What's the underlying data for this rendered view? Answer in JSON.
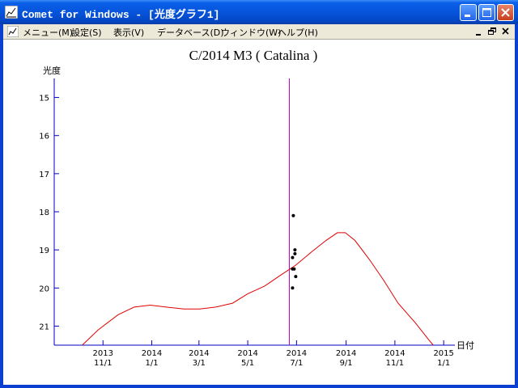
{
  "window": {
    "title": "Comet for Windows - [光度グラフ1]",
    "colors": {
      "titlebar": "#0654db",
      "close_button": "#c5401e",
      "menubar": "#ece9d8"
    }
  },
  "menu": {
    "items": [
      {
        "id": "menu",
        "label": "メニュー(M)"
      },
      {
        "id": "settings",
        "label": "設定(S)"
      },
      {
        "id": "view",
        "label": "表示(V)"
      },
      {
        "id": "database",
        "label": "データベース(D)"
      },
      {
        "id": "window",
        "label": "ウィンドウ(W)"
      },
      {
        "id": "help",
        "label": "ヘルプ(H)"
      }
    ]
  },
  "icons": {
    "app": "graph-icon",
    "minimize": "minimize-icon",
    "maximize": "maximize-icon",
    "close": "close-icon",
    "restore": "restore-icon"
  },
  "chart_data": {
    "type": "line",
    "title": "C/2014 M3 ( Catalina )",
    "ylabel": "光度",
    "xlabel": "日付",
    "y_inverted": true,
    "ylim": [
      21.5,
      14.5
    ],
    "xlim": [
      "2013-09-01",
      "2015-01-15"
    ],
    "y_ticks": [
      15,
      16,
      17,
      18,
      19,
      20,
      21
    ],
    "x_ticks": [
      {
        "date": "2013-11-01",
        "label_top": "2013",
        "label_bottom": "11/1"
      },
      {
        "date": "2014-01-01",
        "label_top": "2014",
        "label_bottom": "1/1"
      },
      {
        "date": "2014-03-01",
        "label_top": "2014",
        "label_bottom": "3/1"
      },
      {
        "date": "2014-05-01",
        "label_top": "2014",
        "label_bottom": "5/1"
      },
      {
        "date": "2014-07-01",
        "label_top": "2014",
        "label_bottom": "7/1"
      },
      {
        "date": "2014-09-01",
        "label_top": "2014",
        "label_bottom": "9/1"
      },
      {
        "date": "2014-11-01",
        "label_top": "2014",
        "label_bottom": "11/1"
      },
      {
        "date": "2015-01-01",
        "label_top": "2015",
        "label_bottom": "1/1"
      }
    ],
    "curve": {
      "color": "#e00000",
      "points": [
        [
          "2013-10-06",
          21.5
        ],
        [
          "2013-10-26",
          21.1
        ],
        [
          "2013-11-20",
          20.7
        ],
        [
          "2013-12-10",
          20.5
        ],
        [
          "2013-12-30",
          20.45
        ],
        [
          "2014-01-19",
          20.5
        ],
        [
          "2014-02-10",
          20.55
        ],
        [
          "2014-03-02",
          20.55
        ],
        [
          "2014-03-22",
          20.5
        ],
        [
          "2014-04-12",
          20.4
        ],
        [
          "2014-05-01",
          20.15
        ],
        [
          "2014-05-22",
          19.95
        ],
        [
          "2014-06-12",
          19.65
        ],
        [
          "2014-06-30",
          19.4
        ],
        [
          "2014-07-20",
          19.05
        ],
        [
          "2014-08-07",
          18.75
        ],
        [
          "2014-08-21",
          18.55
        ],
        [
          "2014-08-31",
          18.55
        ],
        [
          "2014-09-12",
          18.75
        ],
        [
          "2014-09-30",
          19.25
        ],
        [
          "2014-10-18",
          19.8
        ],
        [
          "2014-11-05",
          20.4
        ],
        [
          "2014-11-26",
          20.9
        ],
        [
          "2014-12-13",
          21.35
        ],
        [
          "2014-12-19",
          21.5
        ]
      ]
    },
    "observations": {
      "color": "#000000",
      "points": [
        [
          "2014-06-27",
          18.1
        ],
        [
          "2014-06-29",
          19.0
        ],
        [
          "2014-06-29",
          19.1
        ],
        [
          "2014-06-26",
          19.2
        ],
        [
          "2014-06-26",
          19.5
        ],
        [
          "2014-06-28",
          19.5
        ],
        [
          "2014-06-30",
          19.7
        ],
        [
          "2014-06-26",
          20.0
        ]
      ]
    },
    "today_marker": {
      "date": "2014-06-22",
      "color": "#c000c0"
    },
    "axis_color": "#0000c0"
  }
}
